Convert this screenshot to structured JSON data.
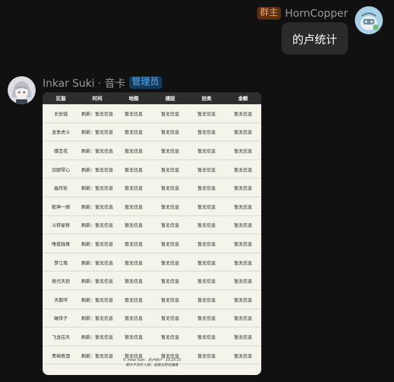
{
  "outgoing": {
    "role_badge": "群主",
    "sender_name": "HornCopper",
    "message": "的卢统计"
  },
  "incoming": {
    "sender_name": "Inkar Suki · 音卡",
    "role_badge": "管理员"
  },
  "table": {
    "headers": [
      "区服",
      "时间",
      "地图",
      "捕捉",
      "拍卖",
      "金额"
    ],
    "rows": [
      [
        "长安城",
        "刷新：暂无信息",
        "暂无信息",
        "暂无信息",
        "暂无信息",
        "暂无信息"
      ],
      [
        "龙争虎斗",
        "刷新：暂无信息",
        "暂无信息",
        "暂无信息",
        "暂无信息",
        "暂无信息"
      ],
      [
        "蝶恋花",
        "刷新：暂无信息",
        "暂无信息",
        "暂无信息",
        "暂无信息",
        "暂无信息"
      ],
      [
        "剑胆琴心",
        "刷新：暂无信息",
        "暂无信息",
        "暂无信息",
        "暂无信息",
        "暂无信息"
      ],
      [
        "幽月轮",
        "刷新：暂无信息",
        "暂无信息",
        "暂无信息",
        "暂无信息",
        "暂无信息"
      ],
      [
        "乾坤一掷",
        "刷新：暂无信息",
        "暂无信息",
        "暂无信息",
        "暂无信息",
        "暂无信息"
      ],
      [
        "斗转星移",
        "刷新：暂无信息",
        "暂无信息",
        "暂无信息",
        "暂无信息",
        "暂无信息"
      ],
      [
        "唯我独尊",
        "刷新：暂无信息",
        "暂无信息",
        "暂无信息",
        "暂无信息",
        "暂无信息"
      ],
      [
        "梦江南",
        "刷新：暂无信息",
        "暂无信息",
        "暂无信息",
        "暂无信息",
        "暂无信息"
      ],
      [
        "绝代天骄",
        "刷新：暂无信息",
        "暂无信息",
        "暂无信息",
        "暂无信息",
        "暂无信息"
      ],
      [
        "天鹅坪",
        "刷新：暂无信息",
        "暂无信息",
        "暂无信息",
        "暂无信息",
        "暂无信息"
      ],
      [
        "破阵子",
        "刷新：暂无信息",
        "暂无信息",
        "暂无信息",
        "暂无信息",
        "暂无信息"
      ],
      [
        "飞龙在天",
        "刷新：暂无信息",
        "暂无信息",
        "暂无信息",
        "暂无信息",
        "暂无信息"
      ],
      [
        "青梅煮酒",
        "刷新：暂无信息",
        "暂无信息",
        "暂无信息",
        "暂无信息",
        "暂无信息"
      ]
    ],
    "footer_line1": "© Inkar Suki · 的卢统计 · 10:23:15",
    "footer_line2": "肥水不流外人田，金额主前往播者"
  },
  "colors": {
    "background": "#111111",
    "bubble": "#2b2b2b",
    "card": "#f5f4ea",
    "header": "#2e2e2e",
    "owner_badge": "#f0a05a",
    "admin_badge": "#4fb0ff"
  }
}
